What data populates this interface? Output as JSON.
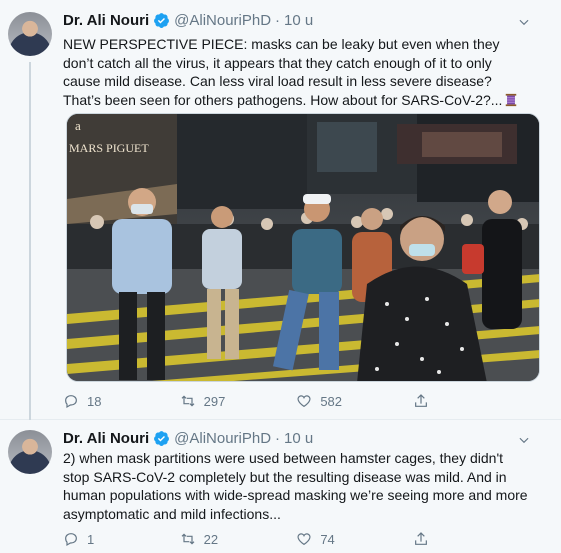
{
  "tweets": [
    {
      "author": "Dr. Ali Nouri",
      "handle": "@AliNouriPhD",
      "time": "10 u",
      "text": "NEW PERSPECTIVE PIECE: masks can be leaky but even when they don’t catch all the virus, it appears that they catch enough of it to only cause mild disease. Can less viral load result in less severe disease? That’s been seen for others pathogens. How about for SARS-CoV-2?...",
      "emoji": "thread-spool-icon",
      "image_sign_text": "MARS PIGUET",
      "image_sign_letter": "a",
      "replies": "18",
      "retweets": "297",
      "likes": "582"
    },
    {
      "author": "Dr. Ali Nouri",
      "handle": "@AliNouriPhD",
      "time": "10 u",
      "text": "2) when mask partitions were used between hamster cages, they didn't stop SARS-CoV-2 completely but the resulting disease was mild. And in human populations with wide-spread masking we’re seeing more and more asymptomatic and mild infections...",
      "replies": "1",
      "retweets": "22",
      "likes": "74"
    }
  ],
  "colors": {
    "text": "#14171a",
    "secondary": "#657786",
    "verified": "#1da1f2",
    "background": "#f5f8fa",
    "thread_line": "#ccd6dd"
  }
}
